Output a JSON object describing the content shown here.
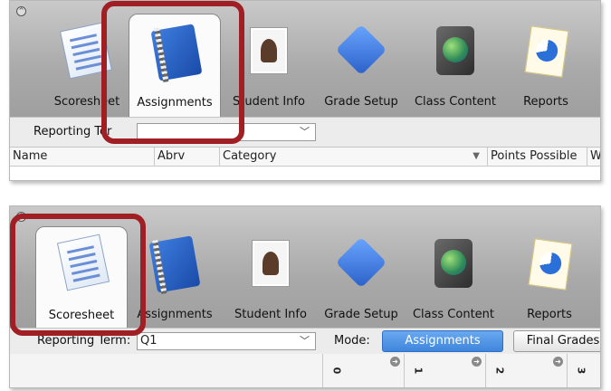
{
  "panel1": {
    "tools": [
      {
        "icon": "scoresheet-icon",
        "label": "Scoresheet"
      },
      {
        "icon": "assignments-icon",
        "label": "Assignments"
      },
      {
        "icon": "student-info-icon",
        "label": "Student Info"
      },
      {
        "icon": "grade-setup-icon",
        "label": "Grade Setup"
      },
      {
        "icon": "class-content-icon",
        "label": "Class Content"
      },
      {
        "icon": "reports-icon",
        "label": "Reports"
      }
    ],
    "active_tool": "Assignments",
    "reporting_term_label": "Reporting Ter",
    "reporting_term_value": "",
    "columns": [
      "Name",
      "Abrv",
      "Category",
      "Points Possible",
      "W"
    ]
  },
  "panel2": {
    "tools": [
      {
        "icon": "scoresheet-icon",
        "label": "Scoresheet"
      },
      {
        "icon": "assignments-icon",
        "label": "Assignments"
      },
      {
        "icon": "student-info-icon",
        "label": "Student Info"
      },
      {
        "icon": "grade-setup-icon",
        "label": "Grade Setup"
      },
      {
        "icon": "class-content-icon",
        "label": "Class Content"
      },
      {
        "icon": "reports-icon",
        "label": "Reports"
      }
    ],
    "active_tool": "Scoresheet",
    "reporting_term_label": "Reporting Term:",
    "reporting_term_value": "Q1",
    "mode_label": "Mode:",
    "mode_options": [
      "Assignments",
      "Final Grades"
    ],
    "mode_selected": "Assignments",
    "assignment_columns": [
      "0",
      "1",
      "2",
      "3"
    ]
  },
  "colors": {
    "highlight": "#a01f25",
    "mode_active": "#4a8fe0"
  }
}
